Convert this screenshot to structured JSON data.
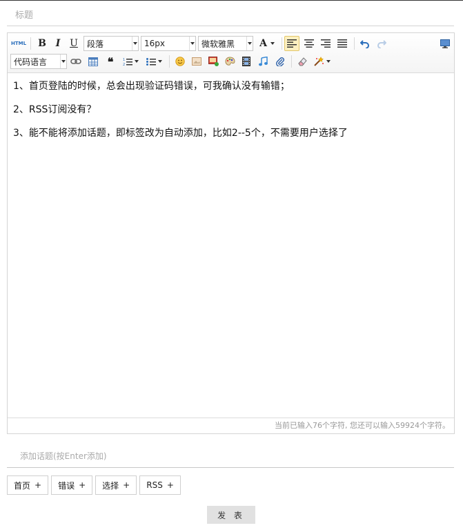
{
  "form": {
    "title_placeholder": "标题",
    "topic_placeholder": "添加话题(按Enter添加)",
    "submit_label": "发 表"
  },
  "toolbar": {
    "html_label": "HTML",
    "bold_label": "B",
    "italic_label": "I",
    "underline_label": "U",
    "paragraph_select": "段落",
    "fontsize_select": "16px",
    "fontfamily_select": "微软雅黑",
    "fontcolor_label": "A",
    "code_lang_select": "代码语言"
  },
  "content": {
    "lines": [
      "1、首页登陆的时候，总会出现验证码错误，可我确认没有输错；",
      "2、RSS订阅没有？",
      "3、能不能将添加话题，即标签改为自动添加，比如2--5个，不需要用户选择了"
    ]
  },
  "status": {
    "counter_text": "当前已输入76个字符, 您还可以输入59924个字符。"
  },
  "tags": [
    {
      "label": "首页",
      "plus": "+"
    },
    {
      "label": "错误",
      "plus": "+"
    },
    {
      "label": "选择",
      "plus": "+"
    },
    {
      "label": "RSS",
      "plus": "+"
    }
  ],
  "colors": {
    "accent_blue": "#2a6ebb",
    "active_bg": "#fdf0c0",
    "border": "#d4d4d4"
  }
}
